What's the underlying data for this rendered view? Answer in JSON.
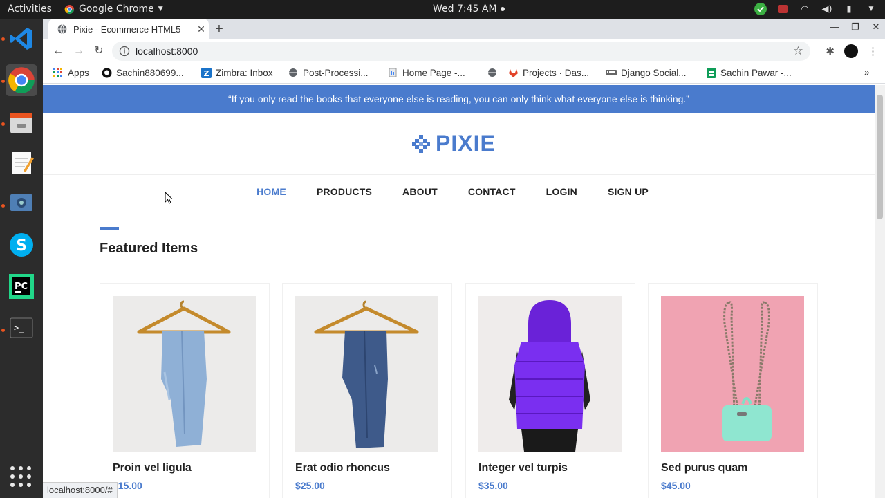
{
  "os": {
    "activities": "Activities",
    "app_menu": "Google Chrome",
    "clock": "Wed  7:45 AM"
  },
  "browser": {
    "tab_title": "Pixie - Ecommerce HTML5",
    "url": "localhost:8000",
    "status_url": "localhost:8000/#",
    "bookmarks": [
      {
        "label": "Apps",
        "icon": "apps-icon"
      },
      {
        "label": "Sachin880699...",
        "icon": "github-icon"
      },
      {
        "label": "Zimbra: Inbox",
        "icon": "zimbra-icon"
      },
      {
        "label": "Post-Processi...",
        "icon": "globe-icon"
      },
      {
        "label": "Home Page -...",
        "icon": "page-icon"
      },
      {
        "label": "",
        "icon": "globe-icon"
      },
      {
        "label": "Projects · Das...",
        "icon": "gitlab-icon"
      },
      {
        "label": "Django Social...",
        "icon": "keyboard-icon"
      },
      {
        "label": "Sachin Pawar -...",
        "icon": "sheets-icon"
      }
    ]
  },
  "page": {
    "quote": "“If you only read the books that everyone else is reading, you can only think what everyone else is thinking.”",
    "logo": "PIXIE",
    "nav": [
      "HOME",
      "PRODUCTS",
      "ABOUT",
      "CONTACT",
      "LOGIN",
      "SIGN UP"
    ],
    "section_title": "Featured Items",
    "products": [
      {
        "name": "Proin vel ligula",
        "price": "$15.00"
      },
      {
        "name": "Erat odio rhoncus",
        "price": "$25.00"
      },
      {
        "name": "Integer vel turpis",
        "price": "$35.00"
      },
      {
        "name": "Sed purus quam",
        "price": "$45.00"
      }
    ],
    "accent_color": "#4a7bcd"
  }
}
